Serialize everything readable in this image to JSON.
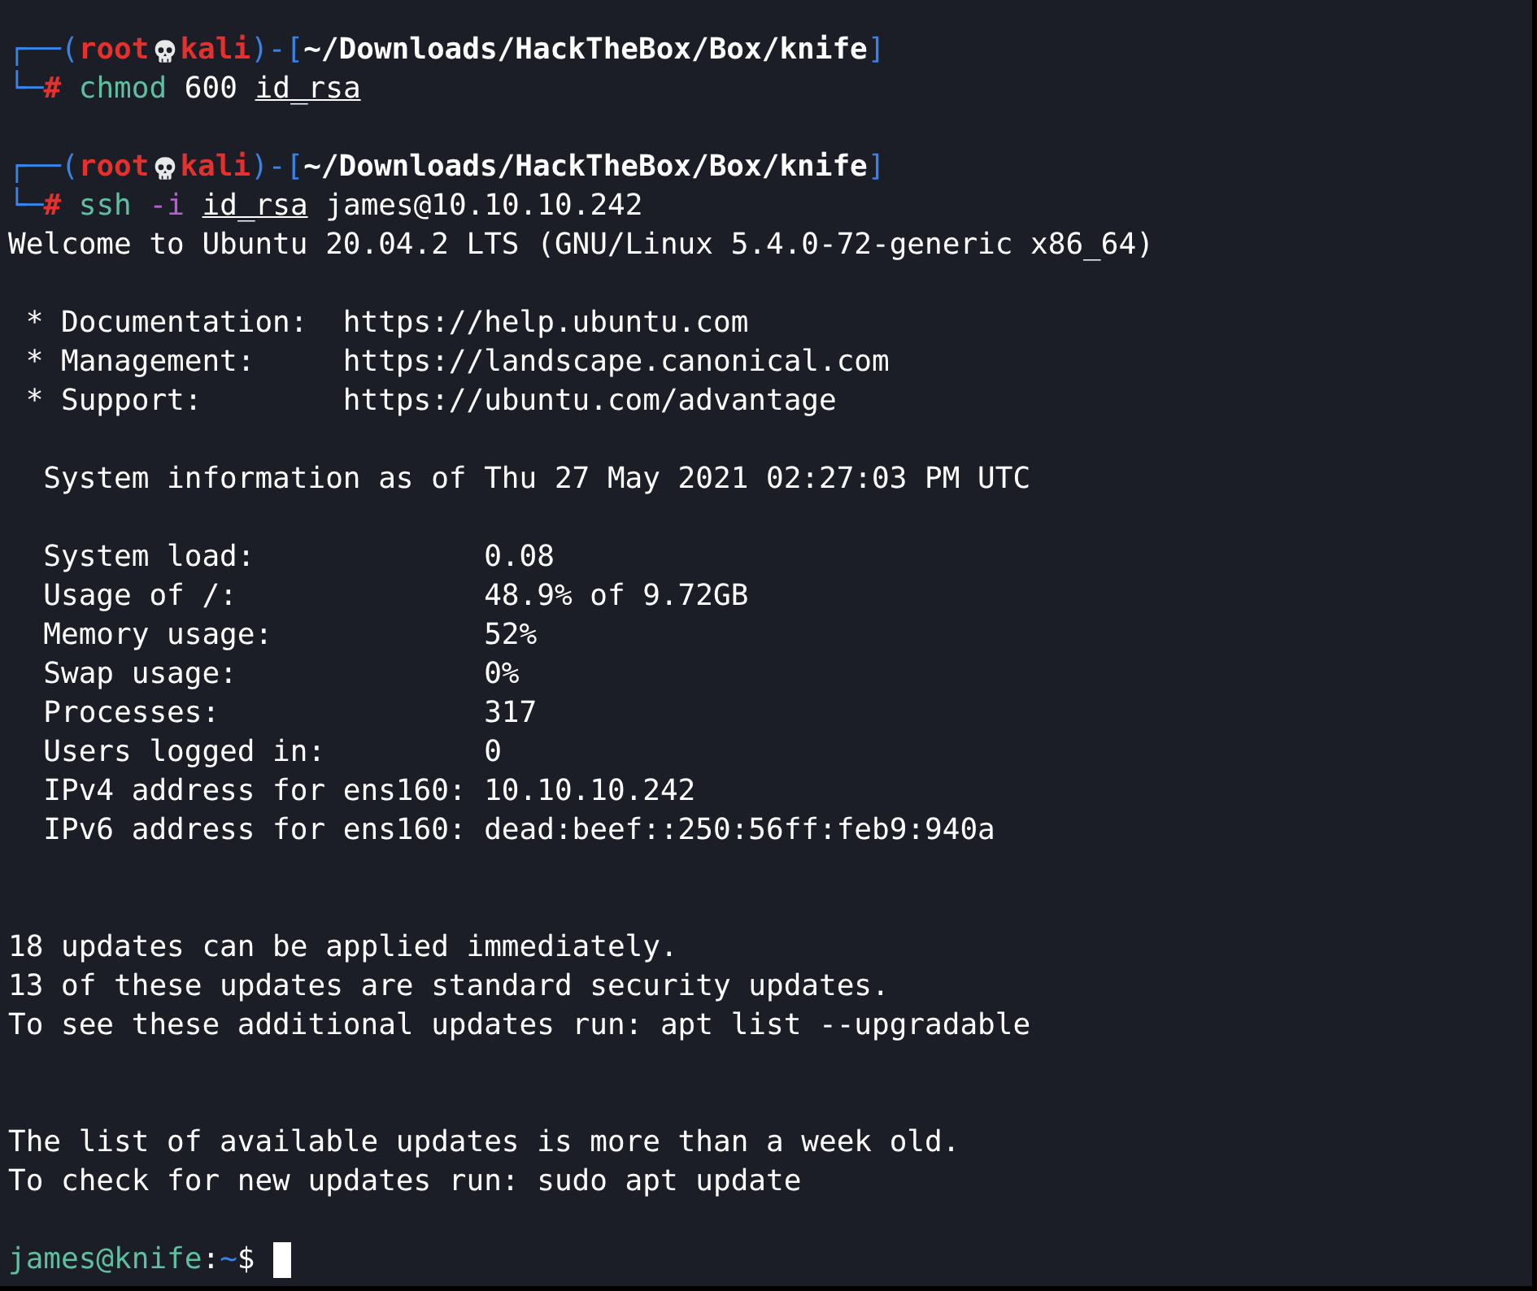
{
  "terminal": {
    "lines": [
      {
        "kind": "prompt",
        "frame_open": "┌──(",
        "user": "root",
        "host": "kali",
        "sep": ")-[",
        "path": "~/Downloads/HackTheBox/Box/knife",
        "frame_close": "]"
      },
      {
        "kind": "command",
        "corner": "└─",
        "symbol": "#",
        "tokens": [
          {
            "text": "chmod",
            "kind": "cmd"
          },
          {
            "text": "600",
            "kind": "arg"
          },
          {
            "text": "id_rsa",
            "kind": "file"
          }
        ]
      },
      {
        "kind": "blank"
      },
      {
        "kind": "prompt",
        "frame_open": "┌──(",
        "user": "root",
        "host": "kali",
        "sep": ")-[",
        "path": "~/Downloads/HackTheBox/Box/knife",
        "frame_close": "]"
      },
      {
        "kind": "command",
        "corner": "└─",
        "symbol": "#",
        "tokens": [
          {
            "text": "ssh",
            "kind": "cmd"
          },
          {
            "text": "-i",
            "kind": "flag"
          },
          {
            "text": "id_rsa",
            "kind": "file"
          },
          {
            "text": "james@10.10.10.242",
            "kind": "arg"
          }
        ]
      },
      {
        "kind": "output",
        "text": "Welcome to Ubuntu 20.04.2 LTS (GNU/Linux 5.4.0-72-generic x86_64)"
      },
      {
        "kind": "blank"
      },
      {
        "kind": "output",
        "text": " * Documentation:  https://help.ubuntu.com"
      },
      {
        "kind": "output",
        "text": " * Management:     https://landscape.canonical.com"
      },
      {
        "kind": "output",
        "text": " * Support:        https://ubuntu.com/advantage"
      },
      {
        "kind": "blank"
      },
      {
        "kind": "output",
        "text": "  System information as of Thu 27 May 2021 02:27:03 PM UTC"
      },
      {
        "kind": "blank"
      },
      {
        "kind": "output",
        "text": "  System load:             0.08"
      },
      {
        "kind": "output",
        "text": "  Usage of /:              48.9% of 9.72GB"
      },
      {
        "kind": "output",
        "text": "  Memory usage:            52%"
      },
      {
        "kind": "output",
        "text": "  Swap usage:              0%"
      },
      {
        "kind": "output",
        "text": "  Processes:               317"
      },
      {
        "kind": "output",
        "text": "  Users logged in:         0"
      },
      {
        "kind": "output",
        "text": "  IPv4 address for ens160: 10.10.10.242"
      },
      {
        "kind": "output",
        "text": "  IPv6 address for ens160: dead:beef::250:56ff:feb9:940a"
      },
      {
        "kind": "blank"
      },
      {
        "kind": "blank"
      },
      {
        "kind": "output",
        "text": "18 updates can be applied immediately."
      },
      {
        "kind": "output",
        "text": "13 of these updates are standard security updates."
      },
      {
        "kind": "output",
        "text": "To see these additional updates run: apt list --upgradable"
      },
      {
        "kind": "blank"
      },
      {
        "kind": "blank"
      },
      {
        "kind": "output",
        "text": "The list of available updates is more than a week old."
      },
      {
        "kind": "output",
        "text": "To check for new updates run: sudo apt update"
      },
      {
        "kind": "blank"
      },
      {
        "kind": "shell",
        "user_host": "james@knife",
        "colon": ":",
        "dir": "~",
        "symbol": "$"
      }
    ]
  }
}
